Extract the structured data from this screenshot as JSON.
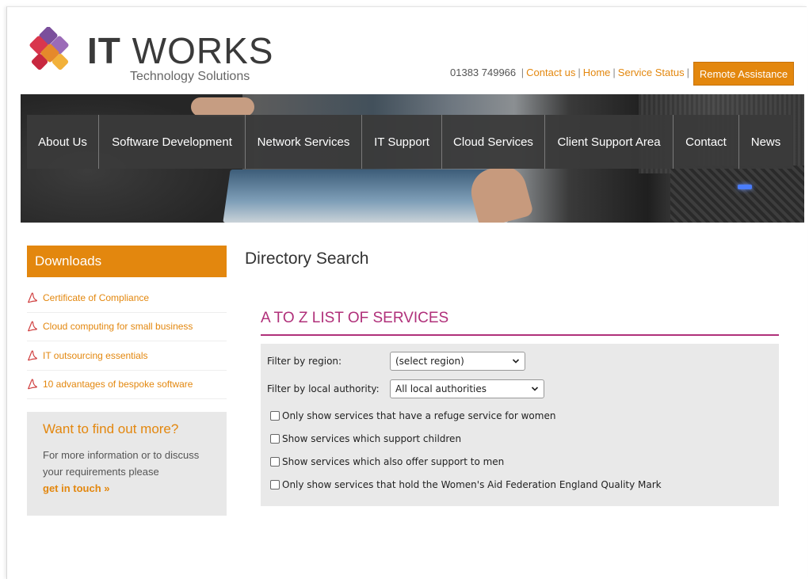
{
  "brand": {
    "name_bold": "IT",
    "name_light": "WORKS",
    "tagline": "Technology Solutions"
  },
  "toplinks": {
    "phone": "01383 749966",
    "contact": "Contact us",
    "home": "Home",
    "status": "Service Status",
    "separator": "|"
  },
  "remote_button": "Remote Assistance",
  "nav": [
    {
      "label": "About Us"
    },
    {
      "label": "Software Development"
    },
    {
      "label": "Network Services"
    },
    {
      "label": "IT Support"
    },
    {
      "label": "Cloud Services"
    },
    {
      "label": "Client Support Area"
    },
    {
      "label": "Contact"
    },
    {
      "label": "News"
    }
  ],
  "sidebar": {
    "downloads_title": "Downloads",
    "downloads": [
      {
        "label": "Certificate of Compliance",
        "icon": "pdf-icon"
      },
      {
        "label": "Cloud computing for small business",
        "icon": "pdf-icon"
      },
      {
        "label": "IT outsourcing essentials",
        "icon": "pdf-icon"
      },
      {
        "label": "10 advantages of bespoke software",
        "icon": "pdf-icon"
      }
    ],
    "findout": {
      "title": "Want to find out more?",
      "text": "For more information or to discuss your requirements please",
      "link": "get in touch »"
    }
  },
  "main": {
    "page_title": "Directory Search",
    "section_title": "A TO Z LIST OF SERVICES",
    "filters": {
      "region_label": "Filter by region:",
      "region_value": "(select region)",
      "authority_label": "Filter by local authority:",
      "authority_value": "All local authorities",
      "checkboxes": [
        {
          "label": "Only show services that have a refuge service for women",
          "checked": false
        },
        {
          "label": "Show services which support children",
          "checked": false
        },
        {
          "label": "Show services which also offer support to men",
          "checked": false
        },
        {
          "label": "Only show services that hold the Women's Aid Federation England Quality Mark",
          "checked": false
        }
      ]
    }
  },
  "colors": {
    "accent": "#e3870e",
    "section": "#b0307a",
    "nav_bg": "#3a3a3a"
  }
}
